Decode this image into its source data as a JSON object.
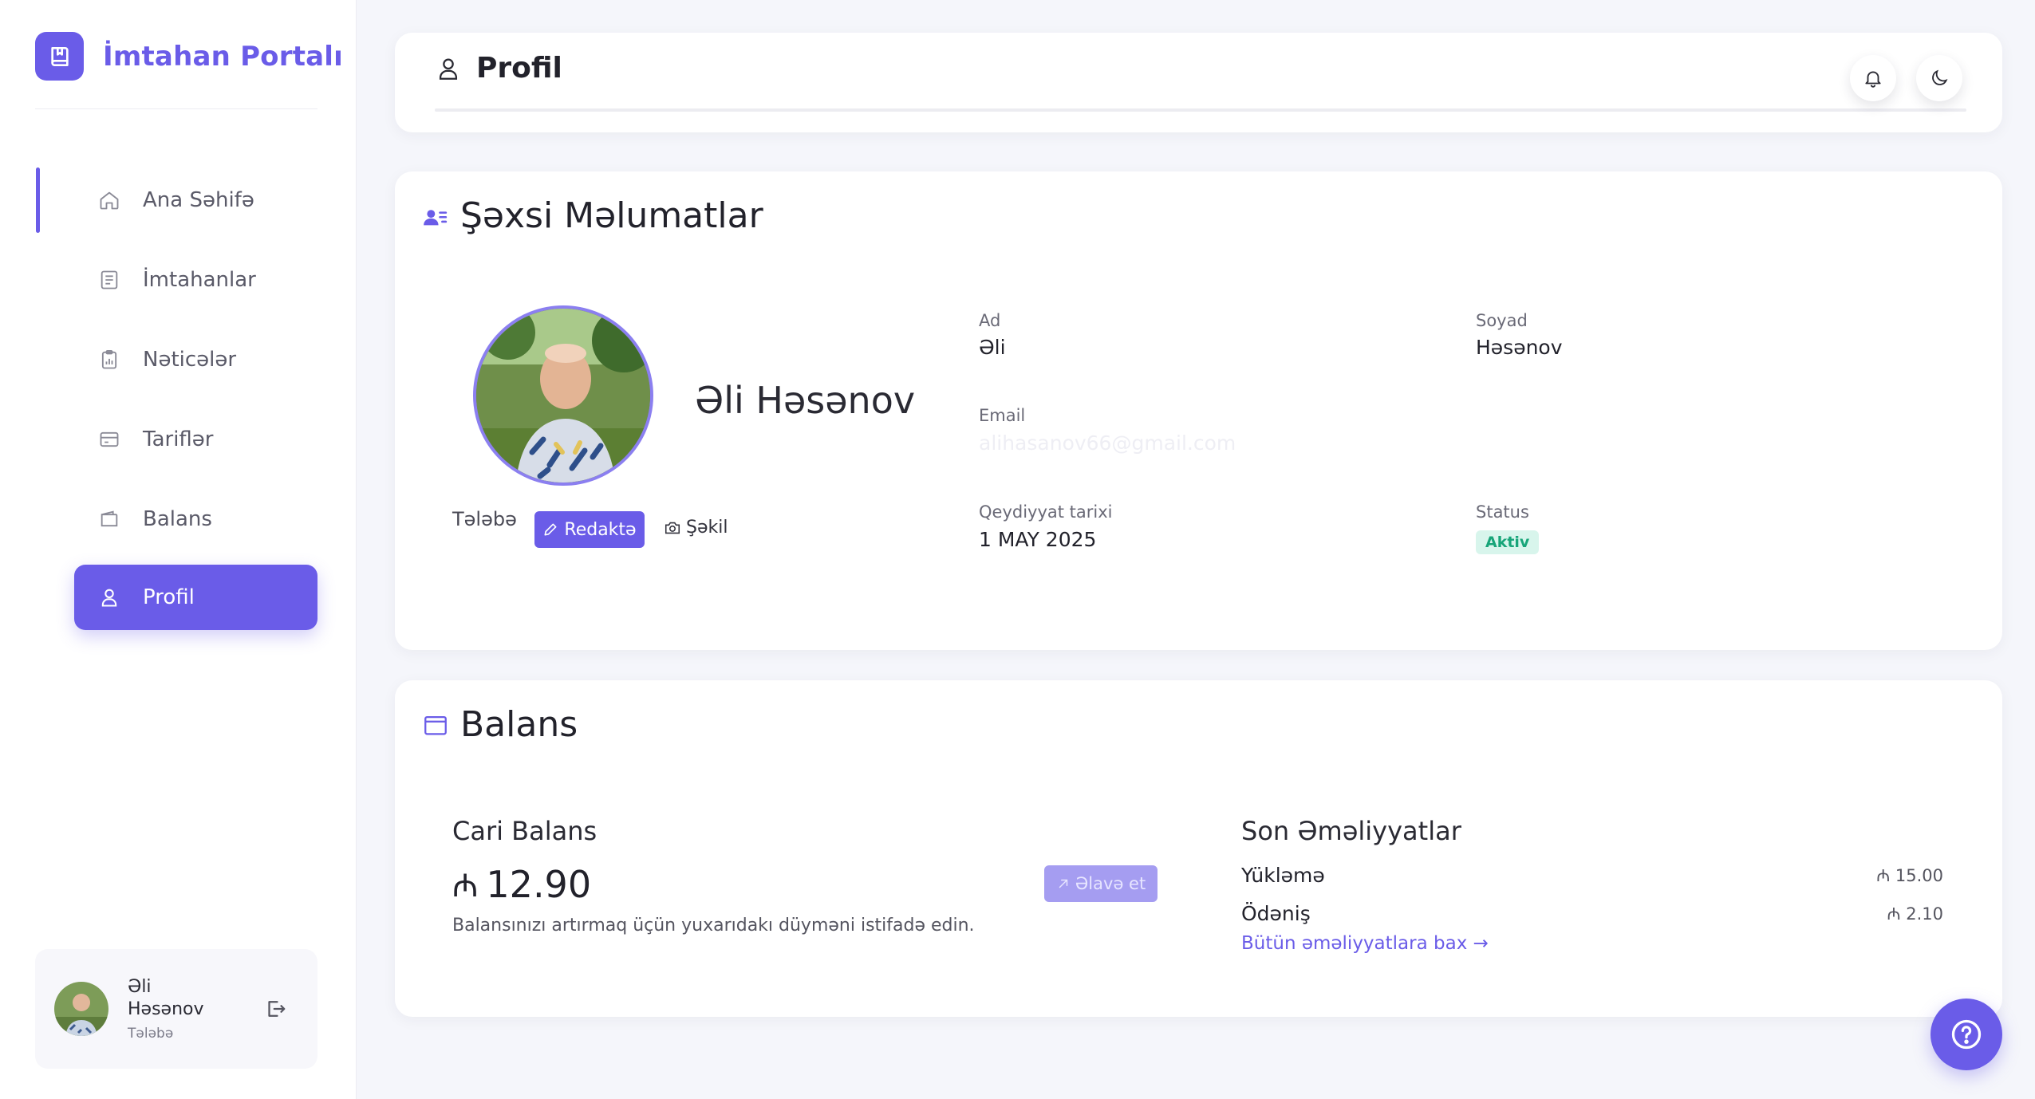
{
  "brand": {
    "name": "İmtahan Portalı",
    "icon": "book-icon"
  },
  "sidebar": {
    "items": [
      {
        "label": "Ana Səhifə",
        "icon": "home-icon"
      },
      {
        "label": "İmtahanlar",
        "icon": "exam-list-icon"
      },
      {
        "label": "Nəticələr",
        "icon": "results-clipboard-icon"
      },
      {
        "label": "Tariflər",
        "icon": "credit-card-icon"
      },
      {
        "label": "Balans",
        "icon": "wallet-icon"
      },
      {
        "label": "Profil",
        "icon": "user-icon",
        "active": true
      }
    ],
    "user": {
      "name": "Əli Həsənov",
      "role": "Tələbə"
    }
  },
  "header": {
    "title": "Profil"
  },
  "personal": {
    "title": "Şəxsi Məlumatlar",
    "full_name": "Əli Həsənov",
    "role": "Tələbə",
    "edit_label": "Redaktə",
    "photo_label": "Şəkil",
    "fields": {
      "first_name_label": "Ad",
      "first_name": "Əli",
      "last_name_label": "Soyad",
      "last_name": "Həsənov",
      "email_label": "Email",
      "email": "alihasanov66@gmail.com",
      "reg_date_label": "Qeydiyyat tarixi",
      "reg_date": "1 MAY 2025",
      "status_label": "Status",
      "status": "Aktiv"
    }
  },
  "balance": {
    "title": "Balans",
    "current_title": "Cari Balans",
    "currency_symbol": "₼",
    "amount": "12.90",
    "hint": "Balansınızı artırmaq üçün yuxarıdakı düyməni istifadə edin.",
    "add_label": "Əlavə et",
    "tx_title": "Son Əməliyyatlar",
    "transactions": [
      {
        "name": "Yükləmə",
        "amount": "₼ 15.00"
      },
      {
        "name": "Ödəniş",
        "amount": "₼ 2.10"
      }
    ],
    "all_link": "Bütün əməliyyatlara bax →"
  },
  "colors": {
    "accent": "#6a5ce8",
    "status_bg": "#d8f5ec",
    "status_fg": "#17a579"
  }
}
